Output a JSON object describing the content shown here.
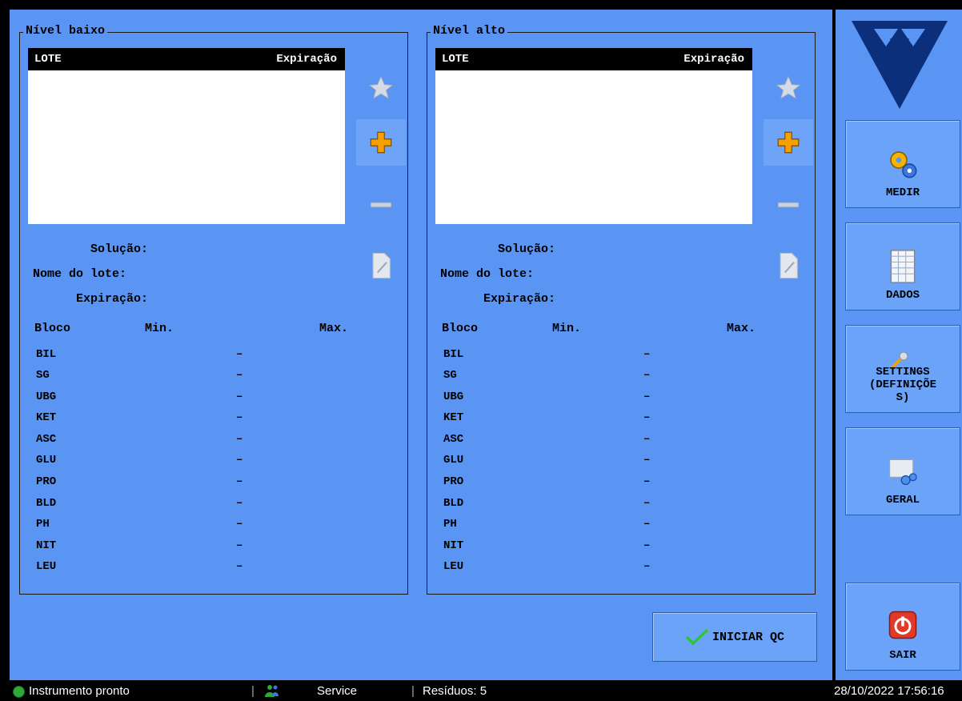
{
  "left_panel": {
    "title": "Nível baixo",
    "list_header": {
      "lot": "LOTE",
      "expiry": "Expiração"
    },
    "fields": {
      "solution": "Solução:",
      "lot_name": "Nome do lote:",
      "expiry": "Expiração:"
    },
    "table_header": {
      "block": "Bloco",
      "min": "Min.",
      "max": "Max."
    },
    "rows": [
      {
        "code": "BIL",
        "value": "–"
      },
      {
        "code": "SG",
        "value": "–"
      },
      {
        "code": "UBG",
        "value": "–"
      },
      {
        "code": "KET",
        "value": "–"
      },
      {
        "code": "ASC",
        "value": "–"
      },
      {
        "code": "GLU",
        "value": "–"
      },
      {
        "code": "PRO",
        "value": "–"
      },
      {
        "code": "BLD",
        "value": "–"
      },
      {
        "code": "PH",
        "value": "–"
      },
      {
        "code": "NIT",
        "value": "–"
      },
      {
        "code": "LEU",
        "value": "–"
      }
    ]
  },
  "right_panel": {
    "title": "Nível alto",
    "list_header": {
      "lot": "LOTE",
      "expiry": "Expiração"
    },
    "fields": {
      "solution": "Solução:",
      "lot_name": "Nome do lote:",
      "expiry": "Expiração:"
    },
    "table_header": {
      "block": "Bloco",
      "min": "Min.",
      "max": "Max."
    },
    "rows": [
      {
        "code": "BIL",
        "value": "–"
      },
      {
        "code": "SG",
        "value": "–"
      },
      {
        "code": "UBG",
        "value": "–"
      },
      {
        "code": "KET",
        "value": "–"
      },
      {
        "code": "ASC",
        "value": "–"
      },
      {
        "code": "GLU",
        "value": "–"
      },
      {
        "code": "PRO",
        "value": "–"
      },
      {
        "code": "BLD",
        "value": "–"
      },
      {
        "code": "PH",
        "value": "–"
      },
      {
        "code": "NIT",
        "value": "–"
      },
      {
        "code": "LEU",
        "value": "–"
      }
    ]
  },
  "start_qc_label": "INICIAR QC",
  "sidebar": {
    "measure": "MEDIR",
    "data": "DADOS",
    "settings_line1": "SETTINGS",
    "settings_line2": "(DEFINIÇÕE",
    "settings_line3": "S)",
    "general": "GERAL",
    "exit": "SAIR"
  },
  "statusbar": {
    "status": "Instrumento pronto",
    "user": "Service",
    "waste": "Resíduos: 5",
    "datetime": "28/10/2022 17:56:16"
  },
  "colors": {
    "background": "#5b95f3",
    "button": "#6aa3f8",
    "status_ok": "#2fa83a",
    "accent_orange": "#f5a000"
  }
}
